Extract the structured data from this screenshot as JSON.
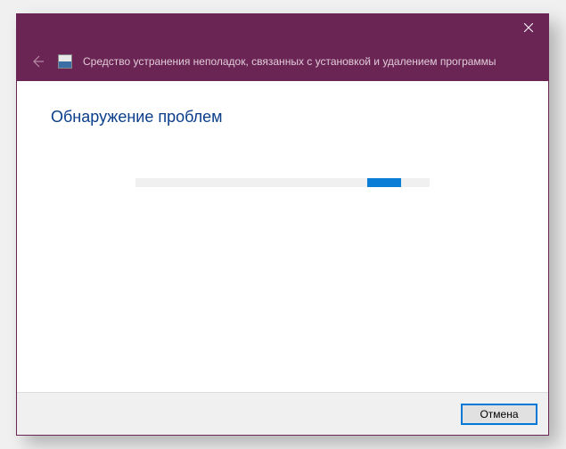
{
  "header": {
    "title": "Средство устранения неполадок, связанных с установкой и удалением программы"
  },
  "content": {
    "heading": "Обнаружение проблем"
  },
  "footer": {
    "cancel_label": "Отмена"
  }
}
